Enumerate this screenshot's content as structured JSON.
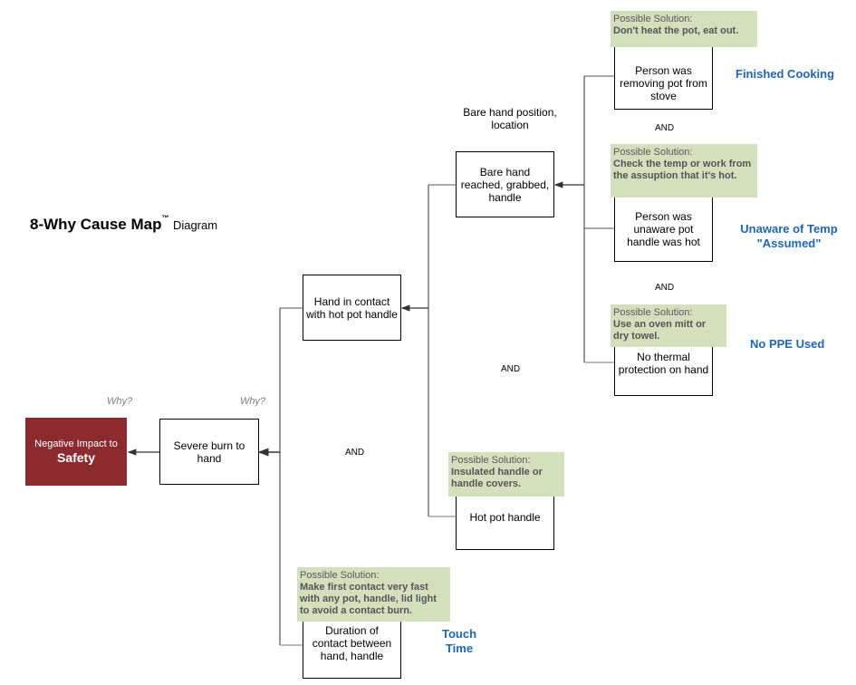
{
  "title": {
    "main": "8-Why Cause Map",
    "trademark": "™",
    "suffix": "Diagram"
  },
  "impact": {
    "label": "Negative Impact to",
    "goal": "Safety",
    "color": "#8b2b30"
  },
  "why_labels": [
    "Why?",
    "Why?"
  ],
  "causes": {
    "severe_burn": "Severe burn to hand",
    "hand_contact": "Hand in contact with hot pot handle",
    "bare_hand": "Bare hand reached, grabbed, handle",
    "bare_hand_header": "Bare hand position, location",
    "removing_pot": "Person was removing pot from stove",
    "unaware": "Person was unaware pot handle was hot",
    "no_thermal": "No thermal protection on hand",
    "hot_handle": "Hot pot handle",
    "duration": "Duration of contact between hand, handle"
  },
  "solutions": {
    "label": "Possible Solution:",
    "removing_pot": "Don't heat the pot, eat out.",
    "unaware": "Check the temp or work from the assuption that it's hot.",
    "no_thermal": "Use an oven mitt or dry towel.",
    "hot_handle": "Insulated handle or handle covers.",
    "duration": "Make first contact very fast with any pot, handle, lid light to avoid a contact burn.",
    "color": "#d3dfbd"
  },
  "tags": {
    "finished_cooking": "Finished Cooking",
    "unaware_line1": "Unaware of Temp",
    "unaware_line2": "\"Assumed\"",
    "no_ppe": "No PPE Used",
    "touch_line1": "Touch",
    "touch_line2": "Time",
    "color": "#1f66b5"
  },
  "and_labels": [
    "AND",
    "AND",
    "AND",
    "AND"
  ]
}
